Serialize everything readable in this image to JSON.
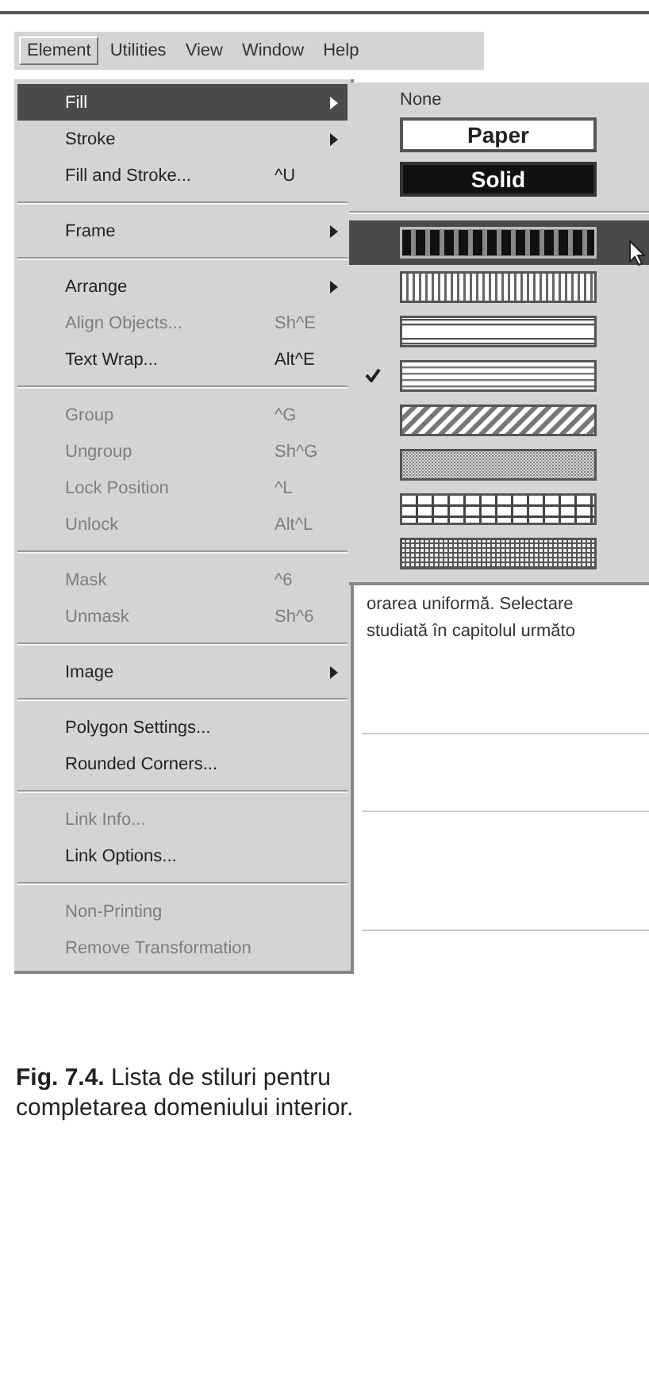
{
  "menubar": [
    {
      "label": "Element",
      "selected": true
    },
    {
      "label": "Utilities",
      "selected": false
    },
    {
      "label": "View",
      "selected": false
    },
    {
      "label": "Window",
      "selected": false
    },
    {
      "label": "Help",
      "selected": false
    }
  ],
  "menu": {
    "items": [
      {
        "kind": "item",
        "label": "Fill",
        "has_submenu": true,
        "disabled": false,
        "selected": true
      },
      {
        "kind": "item",
        "label": "Stroke",
        "has_submenu": true,
        "disabled": false,
        "selected": false
      },
      {
        "kind": "item",
        "label": "Fill and Stroke...",
        "shortcut": "^U",
        "has_submenu": false,
        "disabled": false,
        "selected": false
      },
      {
        "kind": "separator"
      },
      {
        "kind": "item",
        "label": "Frame",
        "has_submenu": true,
        "disabled": false,
        "selected": false
      },
      {
        "kind": "separator"
      },
      {
        "kind": "item",
        "label": "Arrange",
        "has_submenu": true,
        "disabled": false,
        "selected": false
      },
      {
        "kind": "item",
        "label": "Align Objects...",
        "shortcut": "Sh^E",
        "has_submenu": false,
        "disabled": true,
        "selected": false
      },
      {
        "kind": "item",
        "label": "Text Wrap...",
        "shortcut": "Alt^E",
        "has_submenu": false,
        "disabled": false,
        "selected": false
      },
      {
        "kind": "separator"
      },
      {
        "kind": "item",
        "label": "Group",
        "shortcut": "^G",
        "has_submenu": false,
        "disabled": true,
        "selected": false
      },
      {
        "kind": "item",
        "label": "Ungroup",
        "shortcut": "Sh^G",
        "has_submenu": false,
        "disabled": true,
        "selected": false
      },
      {
        "kind": "item",
        "label": "Lock Position",
        "shortcut": "^L",
        "has_submenu": false,
        "disabled": true,
        "selected": false
      },
      {
        "kind": "item",
        "label": "Unlock",
        "shortcut": "Alt^L",
        "has_submenu": false,
        "disabled": true,
        "selected": false
      },
      {
        "kind": "separator"
      },
      {
        "kind": "item",
        "label": "Mask",
        "shortcut": "^6",
        "has_submenu": false,
        "disabled": true,
        "selected": false
      },
      {
        "kind": "item",
        "label": "Unmask",
        "shortcut": "Sh^6",
        "has_submenu": false,
        "disabled": true,
        "selected": false
      },
      {
        "kind": "separator"
      },
      {
        "kind": "item",
        "label": "Image",
        "has_submenu": true,
        "disabled": false,
        "selected": false
      },
      {
        "kind": "separator"
      },
      {
        "kind": "item",
        "label": "Polygon Settings...",
        "has_submenu": false,
        "disabled": false,
        "selected": false
      },
      {
        "kind": "item",
        "label": "Rounded Corners...",
        "has_submenu": false,
        "disabled": false,
        "selected": false
      },
      {
        "kind": "separator"
      },
      {
        "kind": "item",
        "label": "Link Info...",
        "has_submenu": false,
        "disabled": true,
        "selected": false
      },
      {
        "kind": "item",
        "label": "Link Options...",
        "has_submenu": false,
        "disabled": false,
        "selected": false
      },
      {
        "kind": "separator"
      },
      {
        "kind": "item",
        "label": "Non-Printing",
        "has_submenu": false,
        "disabled": true,
        "selected": false
      },
      {
        "kind": "item",
        "label": "Remove Transformation",
        "has_submenu": false,
        "disabled": true,
        "selected": false
      }
    ]
  },
  "submenu": {
    "items": [
      {
        "kind": "text",
        "label": "None"
      },
      {
        "kind": "paper",
        "label": "Paper"
      },
      {
        "kind": "solid",
        "label": "Solid"
      },
      {
        "kind": "separator"
      },
      {
        "kind": "boxes",
        "selected": true,
        "checked": false
      },
      {
        "kind": "vlines",
        "selected": false,
        "checked": false
      },
      {
        "kind": "hbar",
        "selected": false,
        "checked": false
      },
      {
        "kind": "hlines",
        "selected": false,
        "checked": true
      },
      {
        "kind": "diagonal",
        "selected": false,
        "checked": false
      },
      {
        "kind": "dots",
        "selected": false,
        "checked": false
      },
      {
        "kind": "grid",
        "selected": false,
        "checked": false
      },
      {
        "kind": "finegrid",
        "selected": false,
        "checked": false
      }
    ]
  },
  "document": {
    "lines": [
      "orarea uniformă. Selectare",
      "studiată în capitolul următo"
    ]
  },
  "caption": "**Fig. 7.4.** Lista de stiluri pentru completarea domeniului interior."
}
